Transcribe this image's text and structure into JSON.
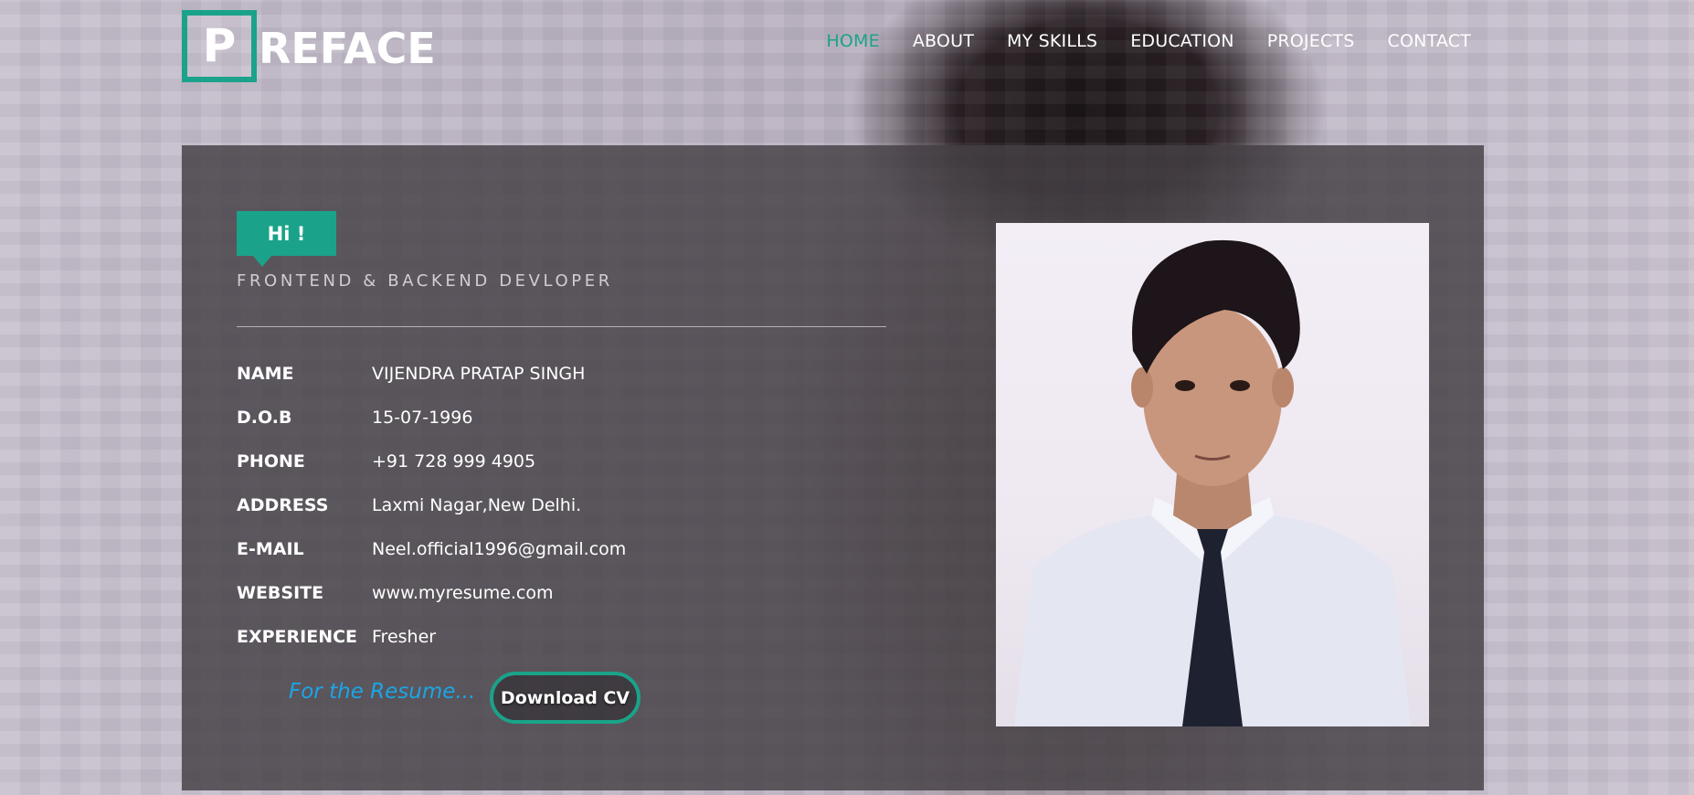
{
  "logo": {
    "initial": "P",
    "rest": "REFACE"
  },
  "nav": {
    "items": [
      {
        "label": "HOME",
        "active": true
      },
      {
        "label": "ABOUT",
        "active": false
      },
      {
        "label": "MY SKILLS",
        "active": false
      },
      {
        "label": "EDUCATION",
        "active": false
      },
      {
        "label": "PROJECTS",
        "active": false
      },
      {
        "label": "CONTACT",
        "active": false
      }
    ]
  },
  "hero": {
    "greeting": "Hi !",
    "role": "FRONTEND & BACKEND DEVLOPER",
    "info": [
      {
        "label": "NAME",
        "value": "VIJENDRA PRATAP SINGH"
      },
      {
        "label": "D.O.B",
        "value": "15-07-1996"
      },
      {
        "label": "PHONE",
        "value": "+91 728 999 4905"
      },
      {
        "label": "ADDRESS",
        "value": "Laxmi Nagar,New Delhi."
      },
      {
        "label": "E-MAIL",
        "value": "Neel.official1996@gmail.com"
      },
      {
        "label": "WEBSITE",
        "value": "www.myresume.com"
      },
      {
        "label": "EXPERIENCE",
        "value": "Fresher"
      }
    ],
    "resume_note": "For the Resume...",
    "download_label": "Download CV"
  },
  "colors": {
    "accent": "#1aa38a",
    "note": "#1aa6e6",
    "card": "#444044"
  }
}
